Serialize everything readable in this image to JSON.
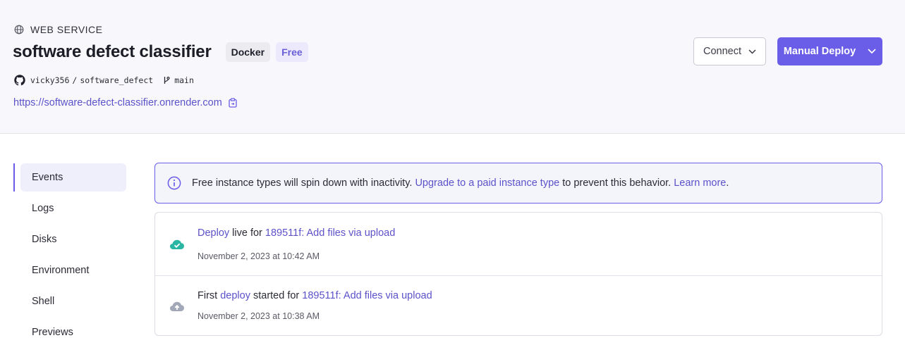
{
  "header": {
    "service_type": "WEB SERVICE",
    "title": "software defect classifier",
    "badges": {
      "runtime": "Docker",
      "plan": "Free"
    },
    "repo": {
      "owner": "vicky356",
      "separator": "/",
      "name": "software_defect",
      "branch": "main"
    },
    "url": "https://software-defect-classifier.onrender.com",
    "connect_label": "Connect",
    "deploy_label": "Manual Deploy"
  },
  "sidebar": {
    "items": [
      {
        "label": "Events"
      },
      {
        "label": "Logs"
      },
      {
        "label": "Disks"
      },
      {
        "label": "Environment"
      },
      {
        "label": "Shell"
      },
      {
        "label": "Previews"
      }
    ]
  },
  "banner": {
    "text_before": "Free instance types will spin down with inactivity. ",
    "upgrade_link": "Upgrade to a paid instance type",
    "text_middle": " to prevent this behavior. ",
    "learn_link": "Learn more",
    "text_after": "."
  },
  "events": [
    {
      "icon": "cloud-check-icon",
      "action_link": "Deploy",
      "text_mid": " live for ",
      "commit_link": "189511f",
      "commit_msg": ": Add files via upload",
      "time": "November 2, 2023 at 10:42 AM"
    },
    {
      "icon": "cloud-upload-icon",
      "prefix": "First ",
      "action_link": "deploy",
      "text_mid": " started for ",
      "commit_link": "189511f",
      "commit_msg": ": Add files via upload",
      "time": "November 2, 2023 at 10:38 AM"
    }
  ],
  "colors": {
    "accent": "#6a5de8",
    "link": "#5b52c9",
    "success": "#2bb5a3",
    "muted_icon": "#a3a8b8"
  }
}
